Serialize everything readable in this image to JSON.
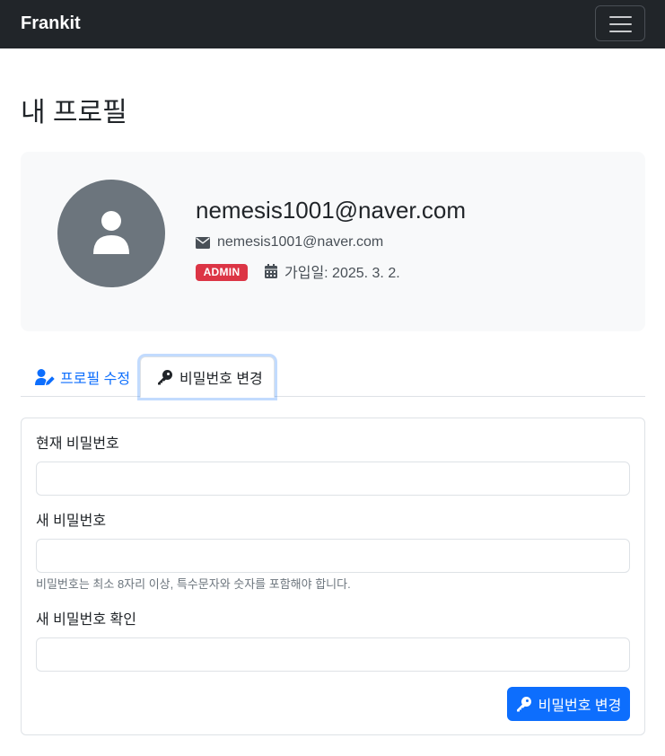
{
  "navbar": {
    "brand": "Frankit",
    "toggle_icon": "hamburger-icon"
  },
  "page": {
    "title": "내 프로필"
  },
  "profile": {
    "avatar_icon": "user-icon",
    "name": "nemesis1001@naver.com",
    "email_icon": "envelope-icon",
    "email": "nemesis1001@naver.com",
    "role_badge": "ADMIN",
    "joined_icon": "calendar-icon",
    "joined": "가입일: 2025. 3. 2."
  },
  "tabs": [
    {
      "label": "프로필 수정",
      "icon": "user-edit-icon",
      "active": false
    },
    {
      "label": "비밀번호 변경",
      "icon": "key-icon",
      "active": true
    }
  ],
  "password_form": {
    "current_label": "현재 비밀번호",
    "current_value": "",
    "new_label": "새 비밀번호",
    "new_value": "",
    "new_help": "비밀번호는 최소 8자리 이상, 특수문자와 숫자를 포함해야 합니다.",
    "confirm_label": "새 비밀번호 확인",
    "confirm_value": "",
    "submit_label": "비밀번호 변경",
    "submit_icon": "key-icon"
  },
  "colors": {
    "navbar": "#212529",
    "primary": "#0d6efd",
    "danger": "#dc3545",
    "avatar": "#6c757d",
    "card_bg": "#f8f9fa"
  }
}
